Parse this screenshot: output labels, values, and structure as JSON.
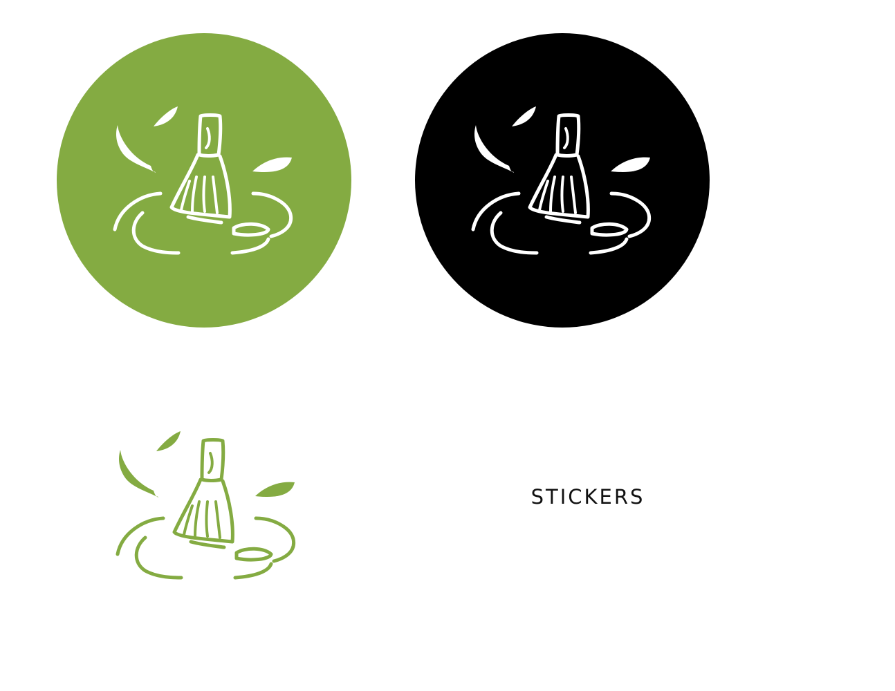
{
  "stickers": [
    {
      "variant": "green",
      "background": "#84ab42",
      "ink": "#ffffff"
    },
    {
      "variant": "black",
      "background": "#000000",
      "ink": "#ffffff"
    },
    {
      "variant": "white",
      "background": "#ffffff",
      "ink": "#84ab42"
    }
  ],
  "icon": "matcha-whisk-icon",
  "caption": "STICKERS"
}
